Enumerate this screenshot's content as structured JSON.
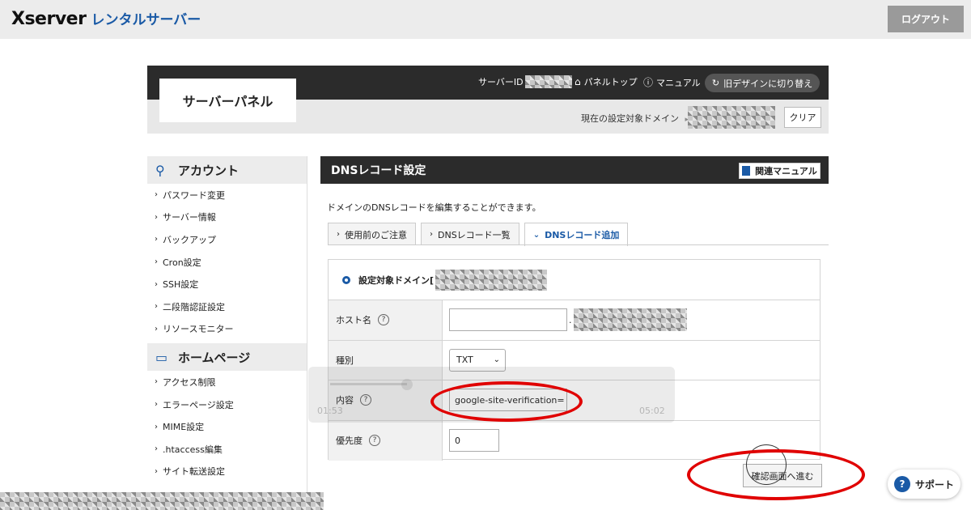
{
  "header": {
    "logo_main": "Xserver",
    "logo_sub": "レンタルサーバー",
    "logout_label": "ログアウト"
  },
  "panel": {
    "title": "サーバーパネル",
    "server_id_label": "サーバーID",
    "panel_top_label": "パネルトップ",
    "manual_label": "マニュアル",
    "old_design_label": "旧デザインに切り替え",
    "current_domain_label": "現在の設定対象ドメイン",
    "clear_label": "クリア"
  },
  "sidebar": {
    "account_title": "アカウント",
    "account_items": [
      "パスワード変更",
      "サーバー情報",
      "バックアップ",
      "Cron設定",
      "SSH設定",
      "二段階認証設定",
      "リソースモニター"
    ],
    "homepage_title": "ホームページ",
    "homepage_items": [
      "アクセス制限",
      "エラーページ設定",
      "MIME設定",
      ".htaccess編集",
      "サイト転送設定"
    ]
  },
  "main": {
    "title": "DNSレコード設定",
    "related_manual": "関連マニュアル",
    "description": "ドメインのDNSレコードを編集することができます。",
    "tabs": [
      "使用前のご注意",
      "DNSレコード一覧",
      "DNSレコード追加"
    ],
    "target_domain_label": "設定対象ドメイン[",
    "fields": {
      "host_label": "ホスト名",
      "type_label": "種別",
      "type_value": "TXT",
      "content_label": "内容",
      "content_value": "google-site-verification=",
      "priority_label": "優先度",
      "priority_value": "0"
    },
    "confirm_label": "確認画面へ進む"
  },
  "video_overlay": {
    "time_left": "01:53",
    "time_right": "05:02"
  },
  "support": {
    "label": "サポート"
  },
  "colors": {
    "accent_blue": "#1a5aa6",
    "dark_header": "#2b2b2b",
    "annotation_red": "#e00000"
  }
}
